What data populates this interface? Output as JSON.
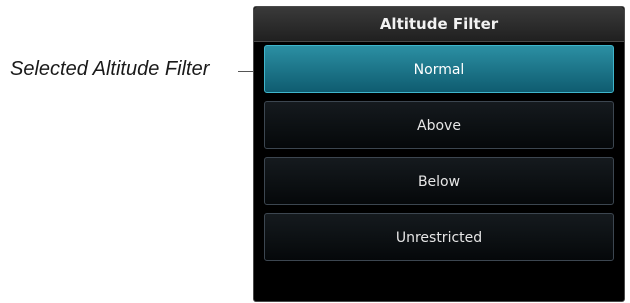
{
  "callout": {
    "label": "Selected Altitude Filter"
  },
  "panel": {
    "title": "Altitude Filter",
    "selected_index": 0,
    "options": [
      {
        "label": "Normal"
      },
      {
        "label": "Above"
      },
      {
        "label": "Below"
      },
      {
        "label": "Unrestricted"
      }
    ]
  },
  "colors": {
    "selected_fill": "#1f7d91",
    "selected_border": "#3fb6cc",
    "button_fill": "#0b0f12",
    "panel_bg": "#000000"
  }
}
